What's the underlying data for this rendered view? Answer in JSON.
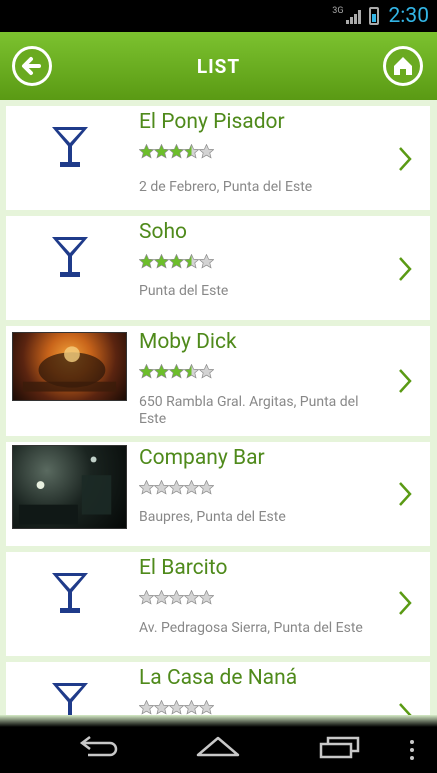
{
  "status": {
    "network": "3G",
    "time": "2:30"
  },
  "header": {
    "title": "LIST",
    "back_icon": "back-arrow-icon",
    "home_icon": "home-icon"
  },
  "colors": {
    "accent": "#5a9a14",
    "name_text": "#4f8a1b",
    "list_bg": "#e6f4da",
    "star_on": "#6cbe2a",
    "star_off": "#d4d4d4"
  },
  "items": [
    {
      "name": "El Pony Pisador",
      "rating": 3.5,
      "address": "2 de Febrero, Punta del Este",
      "image": "cocktail-glass-icon"
    },
    {
      "name": "Soho",
      "rating": 3.5,
      "address": "Punta del Este",
      "image": "cocktail-glass-icon"
    },
    {
      "name": "Moby Dick",
      "rating": 3.5,
      "address": "650 Rambla Gral. Argitas, Punta del Este",
      "image": "photo"
    },
    {
      "name": "Company Bar",
      "rating": 0,
      "address": "Baupres, Punta del Este",
      "image": "photo"
    },
    {
      "name": "El Barcito",
      "rating": 0,
      "address": "Av. Pedragosa Sierra, Punta del Este",
      "image": "cocktail-glass-icon"
    },
    {
      "name": "La Casa de Naná",
      "rating": 0,
      "address": "",
      "image": "cocktail-glass-icon"
    }
  ]
}
